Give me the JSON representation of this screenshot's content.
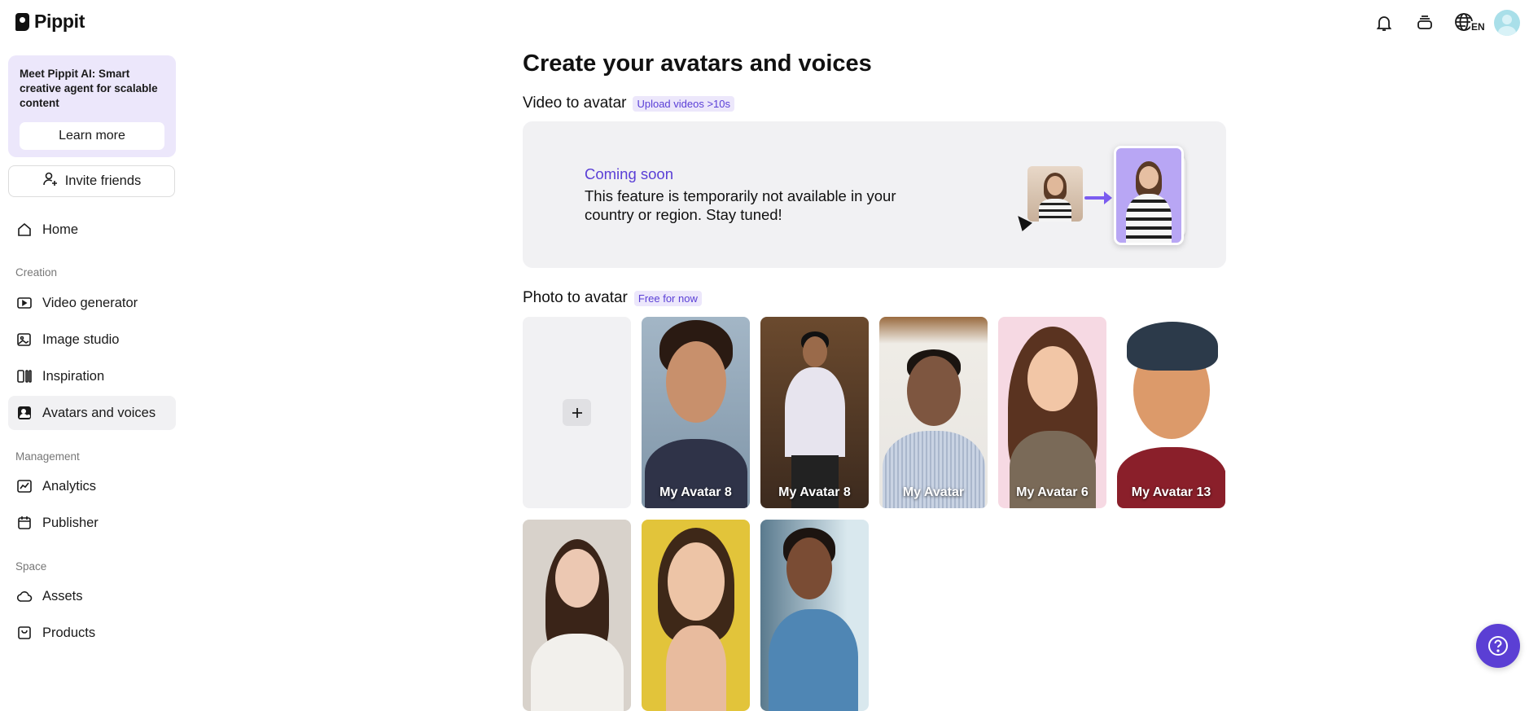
{
  "brand": {
    "name": "Pippit"
  },
  "promo": {
    "text": "Meet Pippit AI: Smart creative agent for scalable content",
    "button_label": "Learn more"
  },
  "invite": {
    "label": "Invite friends",
    "icon": "user-plus-icon"
  },
  "nav": {
    "home": {
      "label": "Home",
      "icon": "home-icon"
    },
    "creation_label": "Creation",
    "creation": [
      {
        "label": "Video generator",
        "icon": "video-plus-icon"
      },
      {
        "label": "Image studio",
        "icon": "image-edit-icon"
      },
      {
        "label": "Inspiration",
        "icon": "inspiration-icon"
      },
      {
        "label": "Avatars and voices",
        "icon": "avatar-icon",
        "active": true
      }
    ],
    "management_label": "Management",
    "management": [
      {
        "label": "Analytics",
        "icon": "analytics-icon"
      },
      {
        "label": "Publisher",
        "icon": "calendar-icon"
      }
    ],
    "space_label": "Space",
    "space": [
      {
        "label": "Assets",
        "icon": "cloud-icon"
      },
      {
        "label": "Products",
        "icon": "bag-icon"
      }
    ]
  },
  "header": {
    "icons": [
      "bell-icon",
      "stack-icon",
      "language-icon",
      "user-avatar"
    ],
    "language": "EN"
  },
  "main": {
    "title": "Create your avatars and voices",
    "video_to_avatar": {
      "title": "Video to avatar",
      "badge": "Upload videos >10s",
      "coming_soon": "Coming soon",
      "notice": "This feature is temporarily not available in your country or region. Stay tuned!"
    },
    "photo_to_avatar": {
      "title": "Photo to avatar",
      "badge": "Free for now",
      "avatars": [
        {
          "caption": "My Avatar 8"
        },
        {
          "caption": "My Avatar 8"
        },
        {
          "caption": "My Avatar"
        },
        {
          "caption": "My Avatar 6"
        },
        {
          "caption": "My Avatar 13"
        },
        {
          "caption": ""
        },
        {
          "caption": ""
        },
        {
          "caption": ""
        }
      ]
    }
  },
  "colors": {
    "accent": "#5b3fd4",
    "badge_bg": "#ece7fb",
    "card_bg": "#f1f1f3"
  }
}
